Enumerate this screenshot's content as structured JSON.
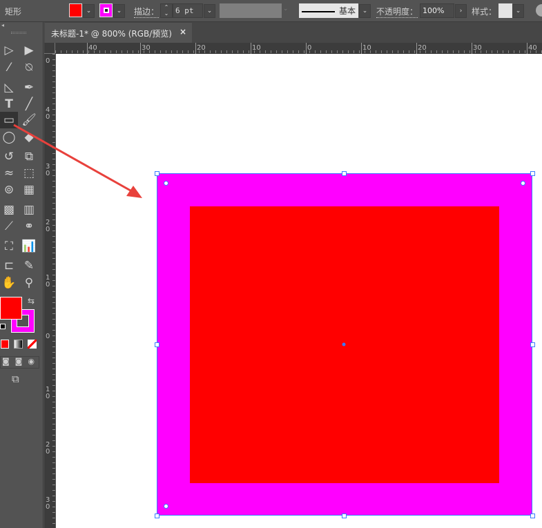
{
  "control_bar": {
    "object_type": "矩形",
    "fill_color": "#ff0000",
    "stroke_color": "#ff00ff",
    "stroke_label": "描边：",
    "stroke_weight": "6 pt",
    "stroke_profile": "基本",
    "opacity_label": "不透明度：",
    "opacity_value": "100%",
    "style_label": "样式："
  },
  "document_tab": {
    "title": "未标题-1* @ 800% (RGB/预览)",
    "close": "×"
  },
  "ruler": {
    "top_labels": [
      "40",
      "30",
      "20",
      "10",
      "0",
      "10",
      "20",
      "30",
      "40"
    ],
    "left_labels": [
      "0",
      "40",
      "30",
      "20",
      "10",
      "0",
      "10",
      "20",
      "30"
    ]
  },
  "toolbar": {
    "fill_color": "#ff0000",
    "stroke_color": "#ff00ff",
    "active_tool": "rectangle-tool"
  },
  "artwork": {
    "shape": "rectangle",
    "fill": "#ff0000",
    "stroke": "#ff00ff",
    "selection_color": "#3a7bff"
  },
  "annotation": {
    "arrow_color": "#e8413c"
  }
}
